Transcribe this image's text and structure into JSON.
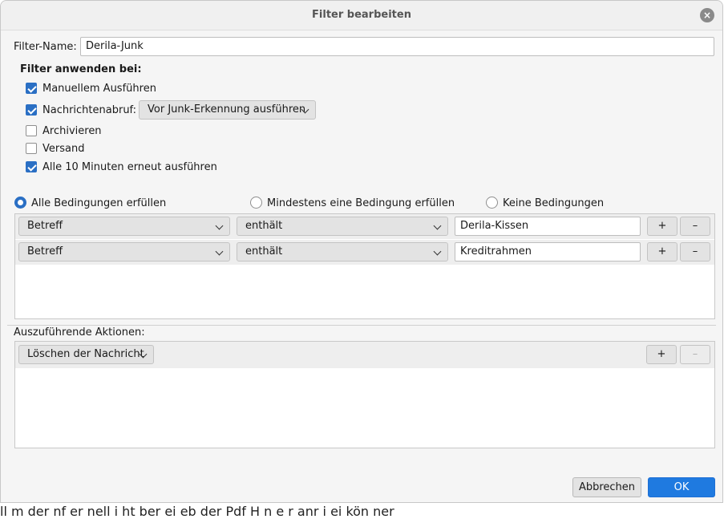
{
  "background": {
    "bottom_text": "ll m der nf er nell i ht ber ei eb der Pdf H n e r anr i ei kön ner"
  },
  "dialog": {
    "title": "Filter bearbeiten",
    "close_icon": "×",
    "filter_name_label": "Filter-Name:",
    "filter_name_value": "Derila-Junk",
    "apply_heading": "Filter anwenden bei:",
    "options": {
      "manual": {
        "label": "Manuellem Ausführen",
        "checked": true
      },
      "fetch": {
        "label": "Nachrichtenabruf:",
        "checked": true,
        "dropdown": "Vor Junk-Erkennung ausführen"
      },
      "archive": {
        "label": "Archivieren",
        "checked": false
      },
      "send": {
        "label": "Versand",
        "checked": false
      },
      "periodic": {
        "label": "Alle 10 Minuten erneut ausführen",
        "checked": true
      }
    },
    "match": {
      "all": "Alle Bedingungen erfüllen",
      "any": "Mindestens eine Bedingung erfüllen",
      "none": "Keine Bedingungen",
      "selected": "all"
    },
    "conditions": [
      {
        "field": "Betreff",
        "operator": "enthält",
        "value": "Derila-Kissen",
        "add": "+",
        "remove": "–"
      },
      {
        "field": "Betreff",
        "operator": "enthält",
        "value": "Kreditrahmen",
        "add": "+",
        "remove": "–"
      }
    ],
    "actions_label": "Auszuführende Aktionen:",
    "actions": [
      {
        "action": "Löschen der Nachricht",
        "add": "+",
        "remove": "–"
      }
    ],
    "cancel_label": "Abbrechen",
    "ok_label": "OK"
  }
}
